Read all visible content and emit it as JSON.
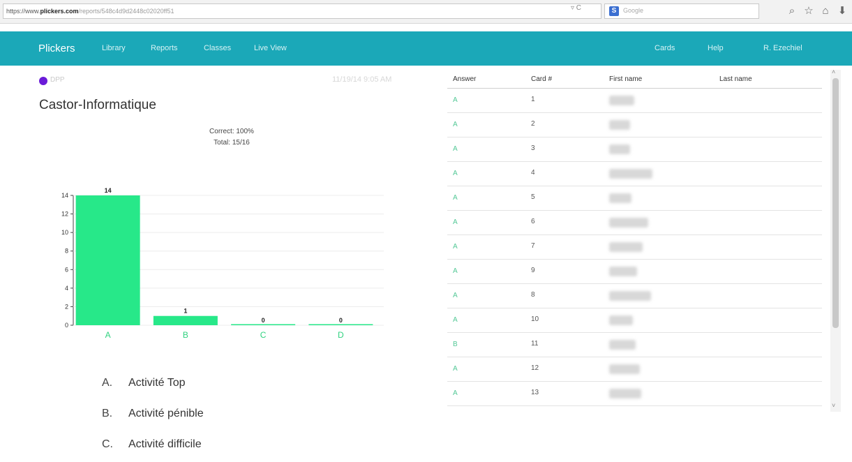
{
  "browser": {
    "url_scheme": "https://www.",
    "url_host": "plickers.com",
    "url_path": "/reports/548c4d9d2448c02020ff51",
    "url_controls": "▿ C",
    "search_engine_badge": "S",
    "search_placeholder": "Google"
  },
  "nav": {
    "brand": "Plickers",
    "items": [
      "Library",
      "Reports",
      "Classes",
      "Live View"
    ],
    "right_items": [
      "Cards",
      "Help",
      "R. Ezechiel"
    ]
  },
  "poll": {
    "tag": "DPP",
    "date": "11/19/14 9:05 AM",
    "title": "Castor-Informatique",
    "correct": "Correct: 100%",
    "total": "Total: 15/16",
    "dot_color": "#6a1bd8"
  },
  "chart_data": {
    "type": "bar",
    "categories": [
      "A",
      "B",
      "C",
      "D"
    ],
    "values": [
      14,
      1,
      0,
      0
    ],
    "ylim": [
      0,
      14
    ],
    "yticks": [
      0,
      2,
      4,
      6,
      8,
      10,
      12,
      14
    ],
    "bar_color": "#27e889",
    "grid": true
  },
  "options": [
    {
      "letter": "A.",
      "text": "Activité Top"
    },
    {
      "letter": "B.",
      "text": "Activité pénible"
    },
    {
      "letter": "C.",
      "text": "Activité difficile"
    }
  ],
  "table": {
    "headers": {
      "answer": "Answer",
      "card": "Card #",
      "first": "First name",
      "last": "Last name"
    },
    "rows": [
      {
        "answer": "A",
        "card": "1"
      },
      {
        "answer": "A",
        "card": "2"
      },
      {
        "answer": "A",
        "card": "3"
      },
      {
        "answer": "A",
        "card": "4"
      },
      {
        "answer": "A",
        "card": "5"
      },
      {
        "answer": "A",
        "card": "6"
      },
      {
        "answer": "A",
        "card": "7"
      },
      {
        "answer": "A",
        "card": "9"
      },
      {
        "answer": "A",
        "card": "8"
      },
      {
        "answer": "A",
        "card": "10"
      },
      {
        "answer": "B",
        "card": "11"
      },
      {
        "answer": "A",
        "card": "12"
      },
      {
        "answer": "A",
        "card": "13"
      }
    ]
  },
  "icons": [
    "search-icon",
    "star-icon",
    "home-icon",
    "download-icon",
    "scroll-up-icon",
    "scroll-down-icon"
  ]
}
